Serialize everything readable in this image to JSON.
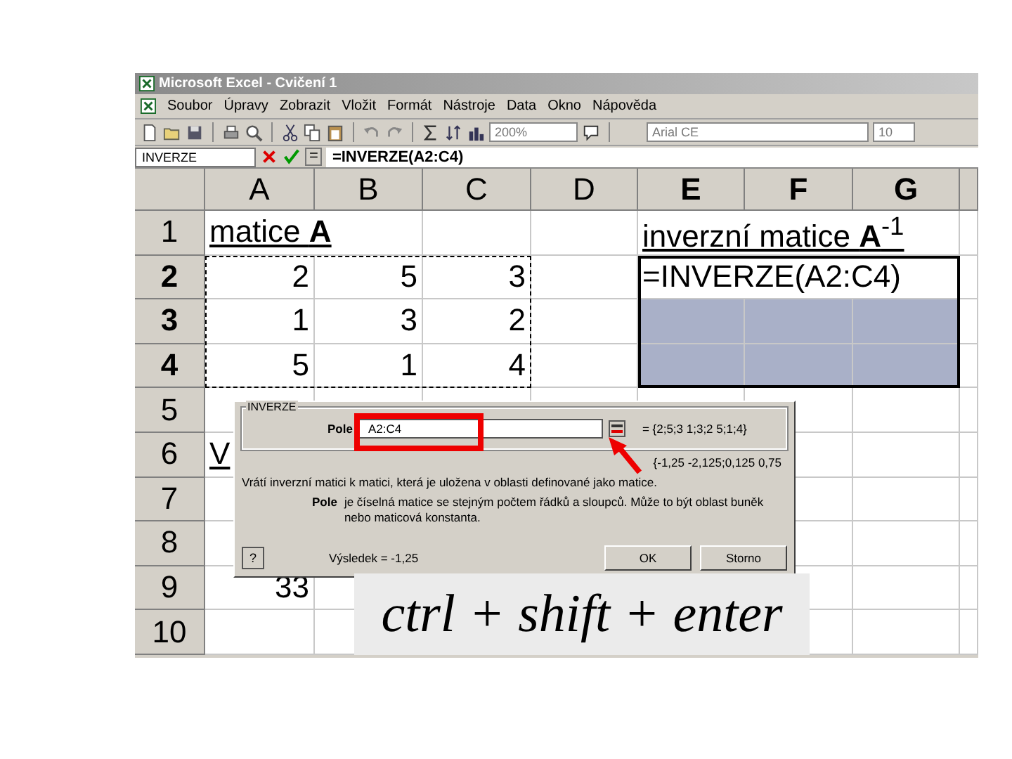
{
  "window": {
    "title": "Microsoft Excel - Cvičení 1"
  },
  "menu": [
    "Soubor",
    "Úpravy",
    "Zobrazit",
    "Vložit",
    "Formát",
    "Nástroje",
    "Data",
    "Okno",
    "Nápověda"
  ],
  "toolbar": {
    "zoom": "200%",
    "font": "Arial CE",
    "size": "10"
  },
  "formula_bar": {
    "name_box": "INVERZE",
    "equals": "=",
    "formula": "=INVERZE(A2:C4)"
  },
  "columns": [
    {
      "label": "A",
      "selected": false
    },
    {
      "label": "B",
      "selected": false
    },
    {
      "label": "C",
      "selected": false
    },
    {
      "label": "D",
      "selected": false
    },
    {
      "label": "E",
      "selected": true
    },
    {
      "label": "F",
      "selected": true
    },
    {
      "label": "G",
      "selected": true
    }
  ],
  "rows": [
    {
      "number": "1",
      "selected": false,
      "cells": {
        "A": {
          "text": "matice **A**",
          "kind": "heading"
        },
        "E": {
          "text": "inverzní matice **A**$^{-1}$",
          "kind": "heading"
        }
      }
    },
    {
      "number": "2",
      "selected": true,
      "cells": {
        "A": {
          "text": "2",
          "kind": "number"
        },
        "B": {
          "text": "5",
          "kind": "number"
        },
        "C": {
          "text": "3",
          "kind": "number"
        },
        "E": {
          "text": "=INVERZE(A2:C4)",
          "kind": "text",
          "selected": false
        }
      }
    },
    {
      "number": "3",
      "selected": true,
      "cells": {
        "A": {
          "text": "1",
          "kind": "number"
        },
        "B": {
          "text": "3",
          "kind": "number"
        },
        "C": {
          "text": "2",
          "kind": "number"
        },
        "E": {
          "selected": true
        },
        "F": {
          "selected": true
        },
        "G": {
          "selected": true
        }
      }
    },
    {
      "number": "4",
      "selected": true,
      "cells": {
        "A": {
          "text": "5",
          "kind": "number"
        },
        "B": {
          "text": "1",
          "kind": "number"
        },
        "C": {
          "text": "4",
          "kind": "number"
        },
        "E": {
          "selected": true
        },
        "F": {
          "selected": true
        },
        "G": {
          "selected": true
        }
      }
    },
    {
      "number": "5",
      "selected": false,
      "cells": {}
    },
    {
      "number": "6",
      "selected": false,
      "cells": {
        "A": {
          "text": "V",
          "kind": "heading"
        }
      }
    },
    {
      "number": "7",
      "selected": false,
      "cells": {}
    },
    {
      "number": "8",
      "selected": false,
      "cells": {}
    },
    {
      "number": "9",
      "selected": false,
      "cells": {
        "A": {
          "text": "33",
          "kind": "number"
        }
      }
    },
    {
      "number": "10",
      "selected": false,
      "cells": {}
    }
  ],
  "dialog": {
    "group": "INVERZE",
    "arg_label": "Pole",
    "arg_value": "A2:C4",
    "arg_result": "= {2;5;3 1;3;2 5;1;4}",
    "result_preview": "{-1,25 -2,125;0,125 0,75",
    "description": "Vrátí inverzní matici k matici, která je uložena v oblasti definované jako matice.",
    "arg_name": "Pole",
    "arg_help": "je číselná matice se stejným počtem řádků a sloupců. Může to být oblast buněk nebo maticová konstanta.",
    "help_button": "?",
    "result": "Výsledek = -1,25",
    "buttons": [
      "OK",
      "Storno"
    ]
  },
  "hint": "ctrl + shift + enter"
}
